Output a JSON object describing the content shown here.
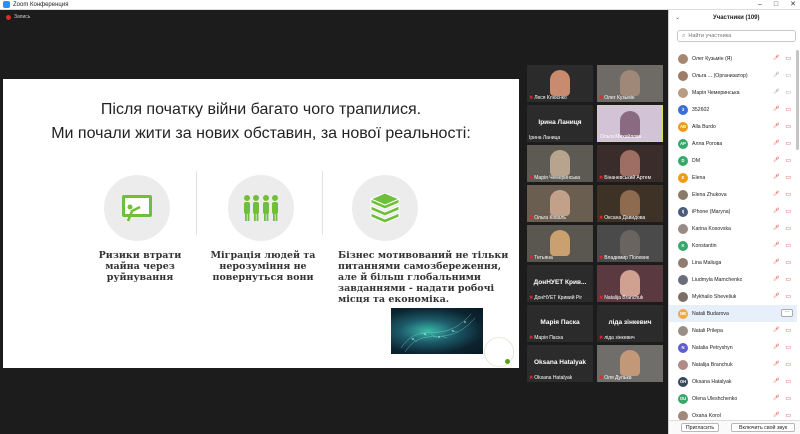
{
  "window": {
    "title": "Zoom Конференция"
  },
  "recording": {
    "label": "Запись"
  },
  "slide": {
    "title_line1": "Після початку війни багато чого трапилися.",
    "title_line2": "Ми почали жити за нових обставин, за нової реальності:",
    "captions": [
      {
        "lines": [
          "Ризики втрати",
          "майна через",
          "руйнування"
        ]
      },
      {
        "lines": [
          "Міграція людей та",
          "нерозуміння не",
          "повернуться вони"
        ]
      },
      {
        "lines": [
          "Бізнес мотивований не тільки",
          "питаннями самозбереження,",
          "але й більш глобальними",
          "завданнями - надати робочі",
          "місця та економіка."
        ]
      }
    ],
    "accent_color": "#6fbf3b"
  },
  "gallery": {
    "tiles": [
      {
        "name": "Леся Клюєнко",
        "center": "",
        "bg": "#4a3a36",
        "av": "#c98b6e"
      },
      {
        "name": "Олег Кузьмін",
        "center": "",
        "bg": "#6e6a66",
        "av": "#a08878"
      },
      {
        "name": "Ірина Ланица",
        "center": "Ірина Ланиця",
        "bg": "#2b2b2b",
        "av": ""
      },
      {
        "name": "Ольга Михайлова",
        "center": "",
        "bg": "#d2c4d6",
        "av": "#8a6a80"
      },
      {
        "name": "Марія Чемеринська",
        "center": "",
        "bg": "#5c5a52",
        "av": "#b8a48e"
      },
      {
        "name": "Бінаневський Артем",
        "center": "",
        "bg": "#3a2c2a",
        "av": "#9e6e62"
      },
      {
        "name": "Ольга Коваль",
        "center": "",
        "bg": "#6a5e50",
        "av": "#c3a08a"
      },
      {
        "name": "Оксана Давидова",
        "center": "",
        "bg": "#3e3226",
        "av": "#8e6a4e"
      },
      {
        "name": "Тетьяна",
        "center": "",
        "bg": "#5a5650",
        "av": "#caa070"
      },
      {
        "name": "Владимир Полевик",
        "center": "",
        "bg": "#4a4a4a",
        "av": "#6a6460"
      },
      {
        "name": "ДонНУЕТ Кривий Ріг",
        "center": "ДонНУЕТ Крив...",
        "bg": "#2b2b2b",
        "av": ""
      },
      {
        "name": "Natalija Branchuk",
        "center": "",
        "bg": "#5a3a40",
        "av": "#d0a090"
      },
      {
        "name": "Марія Паска",
        "center": "Марія Паска",
        "bg": "#2b2b2b",
        "av": ""
      },
      {
        "name": "ліда зінкевич",
        "center": "ліда зінкевич",
        "bg": "#2b2b2b",
        "av": ""
      },
      {
        "name": "Oksana Hatalyak",
        "center": "Oksana Hatalyak",
        "bg": "#2b2b2b",
        "av": ""
      },
      {
        "name": "Оля Дулька",
        "center": "",
        "bg": "#706e6a",
        "av": "#c29878"
      }
    ]
  },
  "panel": {
    "title": "Участники (109)",
    "search_placeholder": "Найти участника",
    "participants": [
      {
        "name": "Олег Кузьмін (Я)",
        "initials": "",
        "color": "#a48872",
        "tag": "",
        "sel": false
      },
      {
        "name": "Ольга ... (Организатор)",
        "initials": "",
        "color": "#9b7c66",
        "tag": "",
        "sel": false
      },
      {
        "name": "Марія Чемеринська",
        "initials": "",
        "color": "#b79c82",
        "tag": "",
        "sel": false
      },
      {
        "name": "352602",
        "initials": "3",
        "color": "#3a6fd8",
        "tag": "",
        "sel": false
      },
      {
        "name": "Alla Burdo",
        "initials": "AB",
        "color": "#f09a1a",
        "tag": "",
        "sel": false
      },
      {
        "name": "Алла Рогова",
        "initials": "AP",
        "color": "#37a86b",
        "tag": "",
        "sel": false
      },
      {
        "name": "DM",
        "initials": "D",
        "color": "#37a86b",
        "tag": "",
        "sel": false
      },
      {
        "name": "Elena",
        "initials": "E",
        "color": "#f09a1a",
        "tag": "",
        "sel": false
      },
      {
        "name": "Elena Zhukova",
        "initials": "",
        "color": "#8a7a6a",
        "tag": "",
        "sel": false
      },
      {
        "name": "iPhone (Maryna)",
        "initials": "I(",
        "color": "#4b5a78",
        "tag": "",
        "sel": false
      },
      {
        "name": "Karina Kosovska",
        "initials": "",
        "color": "#9a8a86",
        "tag": "",
        "sel": false
      },
      {
        "name": "Konstantin",
        "initials": "K",
        "color": "#37a86b",
        "tag": "",
        "sel": false
      },
      {
        "name": "Lina Maliuga",
        "initials": "",
        "color": "#8e7e72",
        "tag": "",
        "sel": false
      },
      {
        "name": "Liudmyla Mamchenko",
        "initials": "",
        "color": "#6a6e7a",
        "tag": "",
        "sel": false
      },
      {
        "name": "Mykhailo Sheveliuk",
        "initials": "",
        "color": "#7a6e66",
        "tag": "",
        "sel": false
      },
      {
        "name": "Natali Budarova",
        "initials": "NB",
        "color": "#f0a84a",
        "tag": "",
        "sel": true
      },
      {
        "name": "Natali Prilepa",
        "initials": "",
        "color": "#9a8e86",
        "tag": "",
        "sel": false
      },
      {
        "name": "Natalia Petryshyn",
        "initials": "N",
        "color": "#5e5ed0",
        "tag": "",
        "sel": false
      },
      {
        "name": "Natalija Branchuk",
        "initials": "",
        "color": "#b08a86",
        "tag": "",
        "sel": false
      },
      {
        "name": "Oksana Hatalyak",
        "initials": "OH",
        "color": "#37475a",
        "tag": "",
        "sel": false
      },
      {
        "name": "Olena Uleshchenko",
        "initials": "OU",
        "color": "#37a86b",
        "tag": "",
        "sel": false
      },
      {
        "name": "Oxana Korol",
        "initials": "",
        "color": "#a0887a",
        "tag": "",
        "sel": false
      }
    ],
    "invite_label": "Пригласить",
    "unmute_label": "Включить свой звук"
  }
}
